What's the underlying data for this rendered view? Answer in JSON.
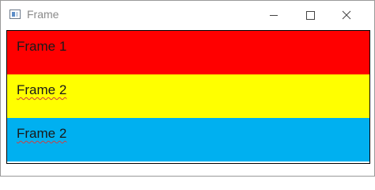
{
  "window": {
    "title": "Frame",
    "icon": "app-window-icon"
  },
  "title_controls": {
    "minimize": "minimize-icon",
    "maximize": "maximize-icon",
    "close": "close-icon"
  },
  "frames": [
    {
      "label": "Frame 1",
      "color": "#ff0000"
    },
    {
      "label": "Frame 2",
      "color": "#ffff00"
    },
    {
      "label": "Frame 2",
      "color": "#00b0f0"
    }
  ]
}
